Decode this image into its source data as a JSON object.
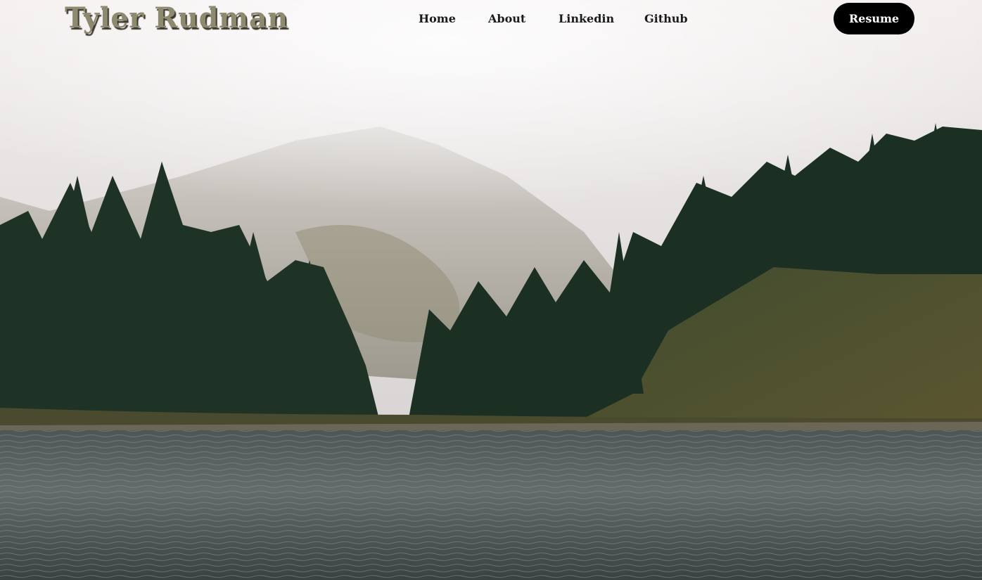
{
  "brand": {
    "name": "Tyler Rudman"
  },
  "nav": {
    "items": [
      {
        "label": "Home"
      },
      {
        "label": "About"
      },
      {
        "label": "Linkedin"
      },
      {
        "label": "Github"
      }
    ],
    "resume_label": "Resume"
  },
  "hero": {
    "image_subject": "misty mountain lake with evergreen forest",
    "colors": {
      "fog": "#e8e4e3",
      "forest": "#1f3325",
      "water": "#3e4746",
      "nav_text": "#1b1b1b",
      "button_bg": "#000000",
      "button_text": "#ffffff",
      "brand_text": "#8e8a6f"
    }
  }
}
